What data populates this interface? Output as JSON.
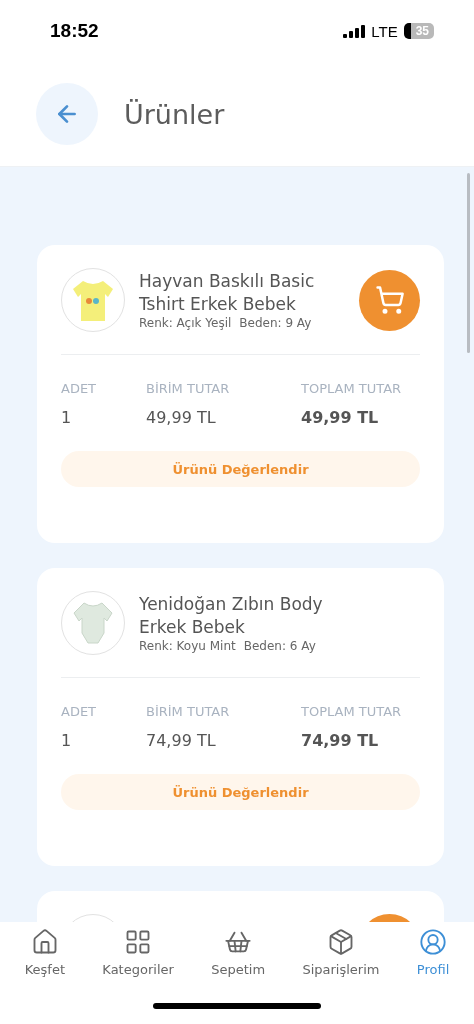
{
  "status_bar": {
    "time": "18:52",
    "network": "LTE",
    "battery": "35"
  },
  "header": {
    "title": "Ürünler"
  },
  "products": [
    {
      "name": "Hayvan Baskılı Basic Tshirt Erkek Bebek",
      "color_label": "Renk: Açık Yeşil",
      "size_label": "Beden: 9 Ay",
      "qty_label": "ADET",
      "unit_label": "BİRİM TUTAR",
      "total_label": "TOPLAM TUTAR",
      "qty": "1",
      "unit_price": "49,99 TL",
      "total_price": "49,99 TL",
      "cart_button": true,
      "review_button": "Ürünü Değerlendir"
    },
    {
      "name": "Yenidoğan Zıbın Body Erkek Bebek",
      "color_label": "Renk: Koyu Mint",
      "size_label": "Beden: 6 Ay",
      "qty_label": "ADET",
      "unit_label": "BİRİM TUTAR",
      "total_label": "TOPLAM TUTAR",
      "qty": "1",
      "unit_price": "74,99 TL",
      "total_price": "74,99 TL",
      "cart_button": false,
      "review_button": "Ürünü Değerlendir"
    }
  ],
  "tab_bar": [
    {
      "label": "Keşfet",
      "selected": false
    },
    {
      "label": "Kategoriler",
      "selected": false
    },
    {
      "label": "Sepetim",
      "selected": false
    },
    {
      "label": "Siparişlerim",
      "selected": false
    },
    {
      "label": "Profil",
      "selected": true
    }
  ]
}
